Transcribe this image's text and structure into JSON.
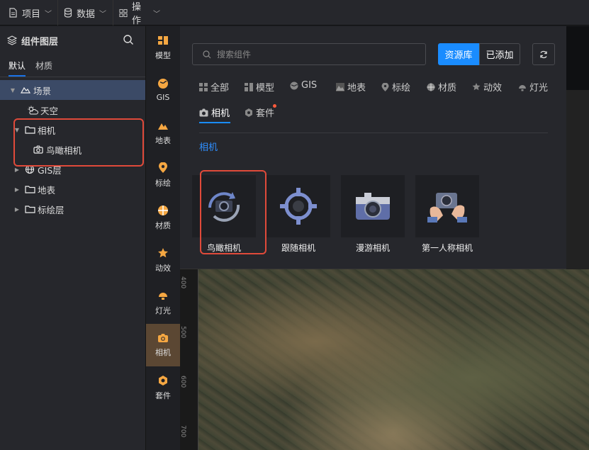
{
  "topbar": {
    "menus": [
      {
        "label": "项目",
        "icon": "document-icon"
      },
      {
        "label": "数据",
        "icon": "database-icon"
      },
      {
        "label": "操作",
        "icon": "grid-icon"
      }
    ]
  },
  "left_panel": {
    "title": "组件图层",
    "tabs": [
      "默认",
      "材质"
    ],
    "tree": [
      {
        "label": "场景",
        "icon": "scene-icon",
        "expanded": true,
        "selected": true
      },
      {
        "label": "天空",
        "icon": "sky-weather-icon"
      },
      {
        "label": "相机",
        "icon": "folder-icon",
        "expanded": true
      },
      {
        "label": "鸟瞰相机",
        "icon": "camera-icon"
      },
      {
        "label": "GIS层",
        "icon": "globe-icon"
      },
      {
        "label": "地表",
        "icon": "folder-icon"
      },
      {
        "label": "标绘层",
        "icon": "folder-icon"
      }
    ]
  },
  "side_nav": {
    "items": [
      "模型",
      "GIS",
      "地表",
      "标绘",
      "材质",
      "动效",
      "灯光",
      "相机",
      "套件"
    ],
    "active": "相机",
    "accent": "#f5a742"
  },
  "popup": {
    "search_placeholder": "搜索组件",
    "btn_library": "资源库",
    "btn_added": "已添加",
    "categories": [
      "全部",
      "模型",
      "GIS",
      "地表",
      "标绘",
      "材质",
      "动效",
      "灯光",
      "相机",
      "套件"
    ],
    "active_category": "相机",
    "section_title": "相机",
    "cards": [
      "鸟瞰相机",
      "跟随相机",
      "漫游相机",
      "第一人称相机"
    ]
  },
  "ruler": {
    "ticks": [
      "400",
      "500",
      "600",
      "700"
    ]
  },
  "colors": {
    "primary": "#1a8cff",
    "highlight": "#e04a3a",
    "selected_bg": "#3b4a66"
  }
}
